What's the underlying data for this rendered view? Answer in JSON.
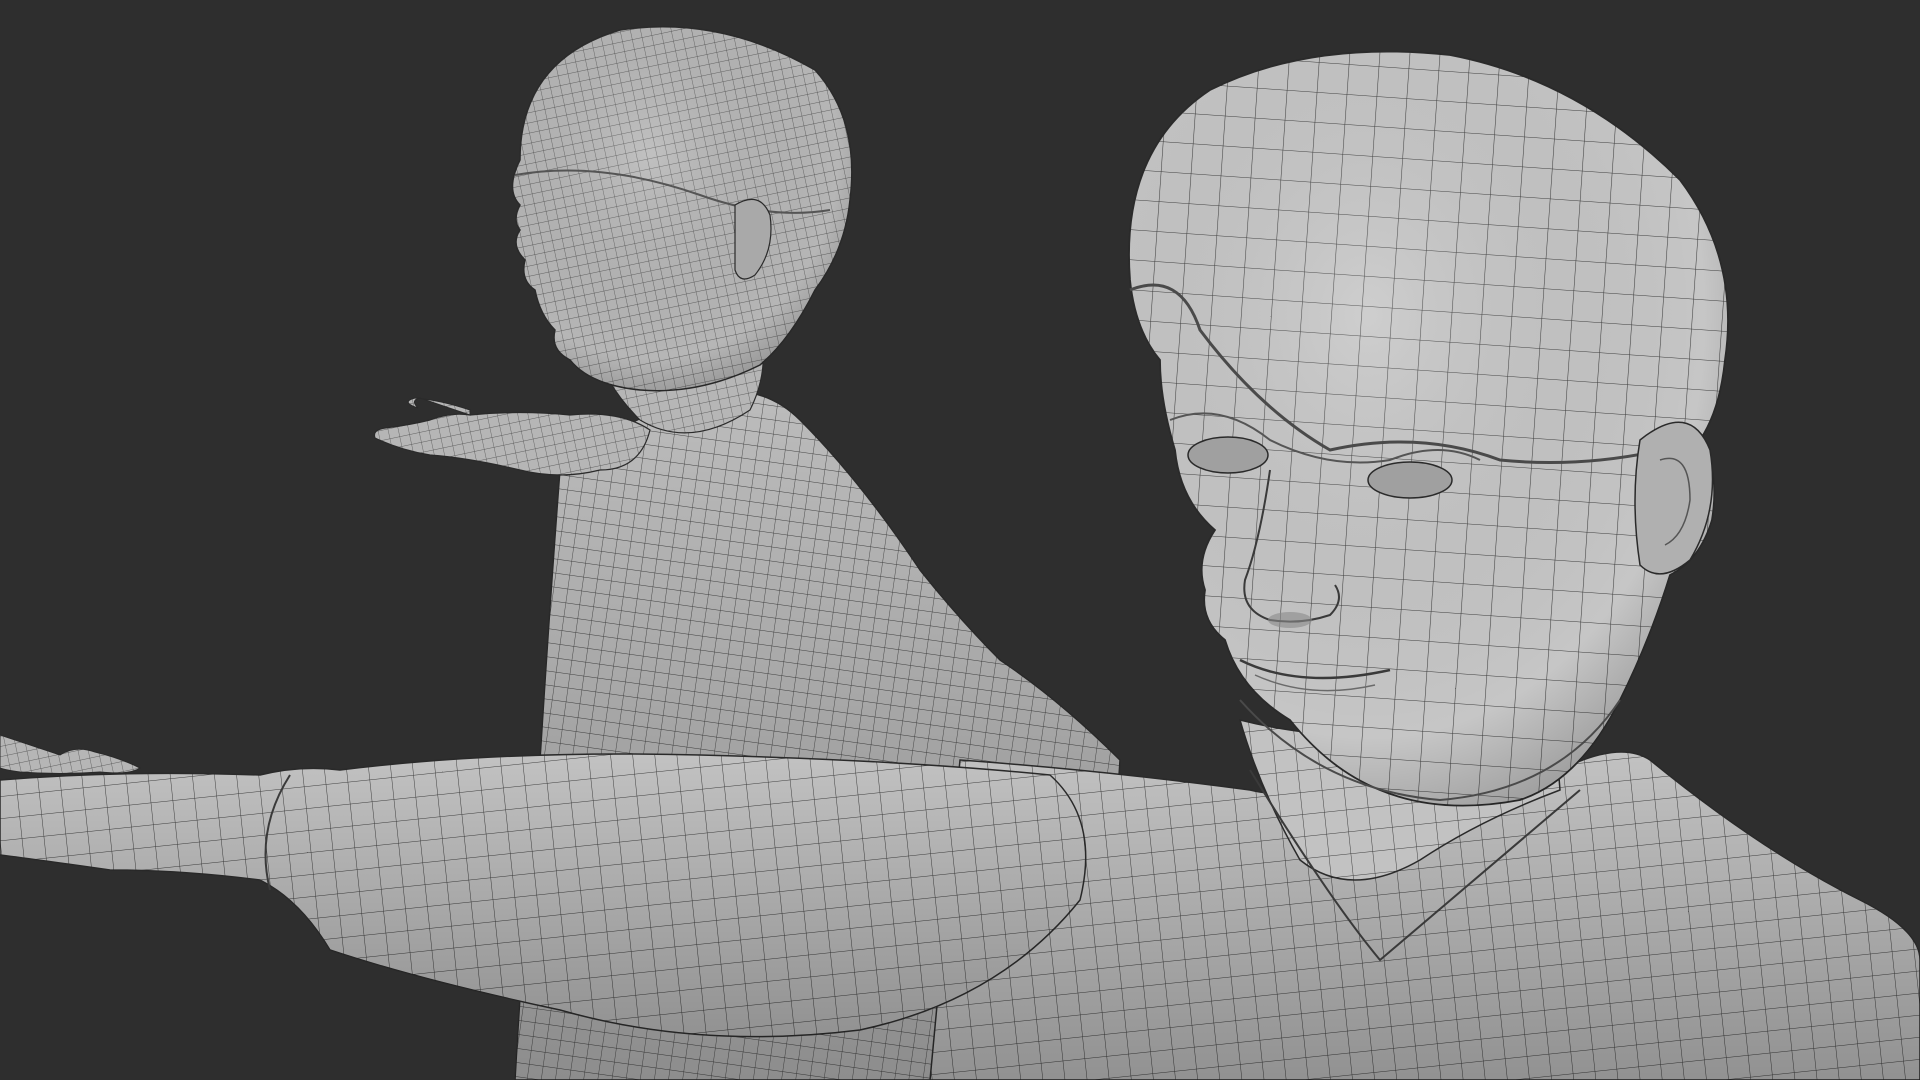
{
  "scene": {
    "background_color": "#2e2e2e",
    "mesh_color": "#b9b9b9",
    "wire_color": "#3c3c3c",
    "shadow_color": "#7a7a7a",
    "subjects": [
      {
        "name": "figure-back",
        "description_hidden": true
      },
      {
        "name": "figure-front",
        "description_hidden": true
      }
    ]
  }
}
